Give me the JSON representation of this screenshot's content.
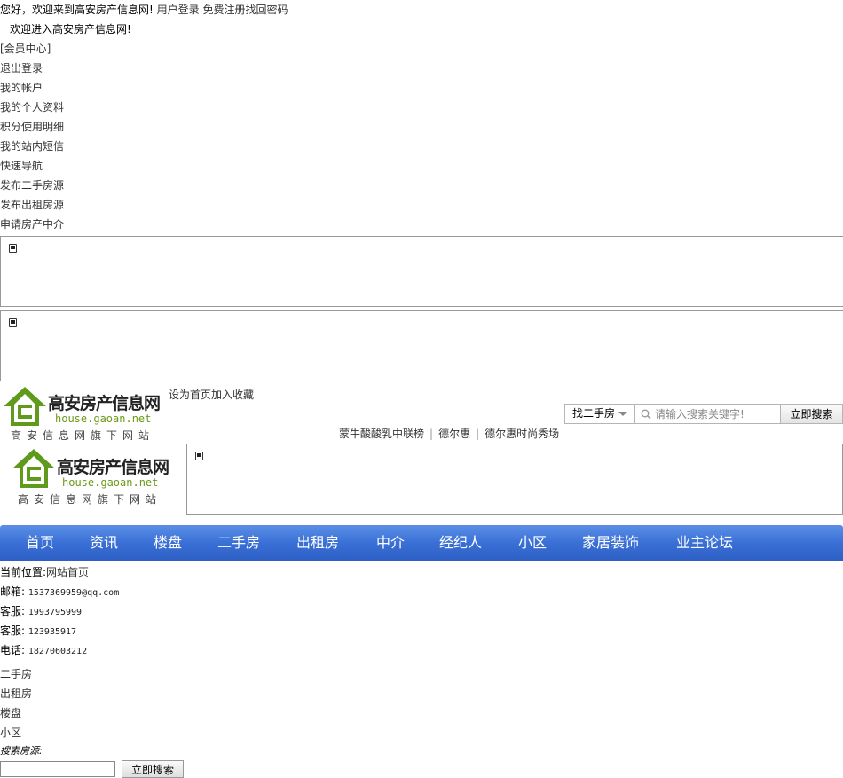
{
  "topbar": {
    "welcome": "您好，欢迎来到高安房产信息网!",
    "login": "用户登录",
    "register": "免费注册",
    "recover": "找回密码"
  },
  "member": {
    "enter": "欢迎进入高安房产信息网!",
    "center": "[会员中心]",
    "items": [
      "退出登录",
      "我的帐户",
      "我的个人资料",
      "积分使用明细",
      "我的站内短信",
      "快速导航",
      "发布二手房源",
      "发布出租房源",
      "申请房产中介"
    ]
  },
  "logo": {
    "brand": "高安房产信息网",
    "domain": "house.gaoan.net",
    "sub": "高安信息网旗下网站"
  },
  "homelinks": {
    "sethome": "设为首页",
    "favorite": "加入收藏"
  },
  "search": {
    "select": "找二手房",
    "placeholder": "请输入搜索关键字!",
    "button": "立即搜索"
  },
  "hotlinks": [
    "蒙牛酸酸乳中联榜",
    "德尔惠",
    "德尔惠时尚秀场"
  ],
  "nav": [
    "首页",
    "资讯",
    "楼盘",
    "二手房",
    "出租房",
    "中介",
    "经纪人",
    "小区",
    "家居装饰",
    "业主论坛"
  ],
  "crumb": {
    "label": "当前位置:",
    "value": "网站首页"
  },
  "contacts": [
    {
      "label": "邮箱:",
      "value": "1537369959@qq.com"
    },
    {
      "label": "客服:",
      "value": "1993795999"
    },
    {
      "label": "客服:",
      "value": "123935917"
    },
    {
      "label": "电话:",
      "value": "18270603212"
    }
  ],
  "types": [
    "二手房",
    "出租房",
    "楼盘",
    "小区"
  ],
  "searchSource": "搜索房源:",
  "bottomButton": "立即搜索",
  "colors": {
    "nav": "#3a70d6",
    "logoGreen": "#6b9a18"
  }
}
